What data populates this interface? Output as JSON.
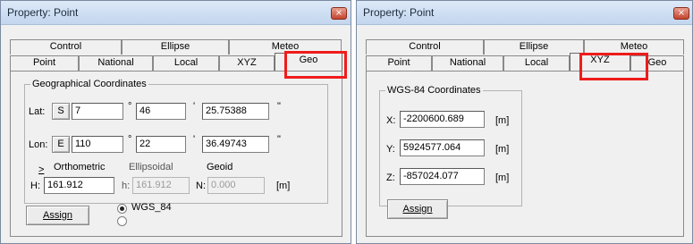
{
  "left_window": {
    "title": "Property: Point",
    "tabs_back": [
      "Control",
      "Ellipse",
      "Meteo"
    ],
    "tabs_front": [
      "Point",
      "National",
      "Local",
      "XYZ",
      "Geo"
    ],
    "active_tab": "Geo",
    "group_label": "Geographical Coordinates",
    "lat": {
      "label": "Lat:",
      "hemisphere": "S",
      "deg": "7",
      "min": "46",
      "sec": "25.75388"
    },
    "lon": {
      "label": "Lon:",
      "hemisphere": "E",
      "deg": "110",
      "min": "22",
      "sec": "36.49743"
    },
    "deg_symbol": "°",
    "min_symbol": "'",
    "sec_symbol": "\"",
    "height_toggle": ">",
    "height_labels": {
      "orthometric": "Orthometric",
      "ellipsoidal": "Ellipsoidal",
      "geoid": "Geoid"
    },
    "h": {
      "label": "H:",
      "value": "161.912"
    },
    "h_ell": {
      "label": "h:",
      "value": "161.912"
    },
    "n": {
      "label": "N:",
      "value": "0.000"
    },
    "unit": "[m]",
    "assign_label": "Assign",
    "datum_options": [
      "WGS_84",
      ""
    ],
    "close_symbol": "×"
  },
  "right_window": {
    "title": "Property: Point",
    "tabs_back": [
      "Control",
      "Ellipse",
      "Meteo"
    ],
    "tabs_front": [
      "Point",
      "National",
      "Local",
      "XYZ",
      "Geo"
    ],
    "active_tab": "XYZ",
    "group_label": "WGS-84 Coordinates",
    "x": {
      "label": "X:",
      "value": "-2200600.689"
    },
    "y": {
      "label": "Y:",
      "value": "5924577.064"
    },
    "z": {
      "label": "Z:",
      "value": "-857024.077"
    },
    "unit": "[m]",
    "assign_label": "Assign",
    "close_symbol": "×"
  },
  "colors": {
    "highlight": "#ef1c1c",
    "titlebar": "#c3d6ee",
    "close": "#c3442e"
  }
}
